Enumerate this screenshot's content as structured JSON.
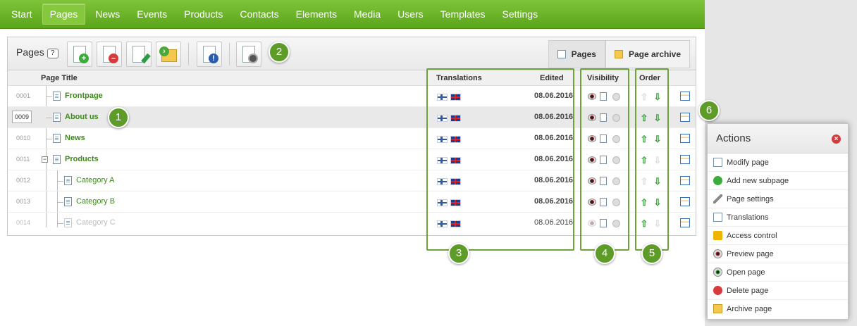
{
  "nav": [
    "Start",
    "Pages",
    "News",
    "Events",
    "Products",
    "Contacts",
    "Elements",
    "Media",
    "Users",
    "Templates",
    "Settings"
  ],
  "nav_active": "Pages",
  "panel": {
    "title": "Pages",
    "help": "?",
    "tabs": [
      {
        "label": "Pages",
        "active": true
      },
      {
        "label": "Page archive",
        "active": false
      }
    ]
  },
  "table": {
    "headers": {
      "page_title": "Page Title",
      "translations": "Translations",
      "edited": "Edited",
      "visibility": "Visibility",
      "order": "Order"
    },
    "rows": [
      {
        "id": "0001",
        "title": "Frontpage",
        "edited": "08.06.2016"
      },
      {
        "id": "0009",
        "title": "About us",
        "edited": "08.06.2016"
      },
      {
        "id": "0010",
        "title": "News",
        "edited": "08.06.2016"
      },
      {
        "id": "0011",
        "title": "Products",
        "edited": "08.06.2016"
      },
      {
        "id": "0012",
        "title": "Category A",
        "edited": "08.06.2016"
      },
      {
        "id": "0013",
        "title": "Category B",
        "edited": "08.06.2016"
      },
      {
        "id": "0014",
        "title": "Category C",
        "edited": "08.06.2016"
      }
    ]
  },
  "callouts": [
    "1",
    "2",
    "3",
    "4",
    "5",
    "6"
  ],
  "actions": {
    "title": "Actions",
    "items": [
      "Modify page",
      "Add new subpage",
      "Page settings",
      "Translations",
      "Access control",
      "Preview page",
      "Open page",
      "Delete page",
      "Archive page"
    ]
  },
  "colors": {
    "accent_green": "#5aa51a",
    "link_green": "#3d8a1a",
    "callout_green": "#5d9c28"
  }
}
